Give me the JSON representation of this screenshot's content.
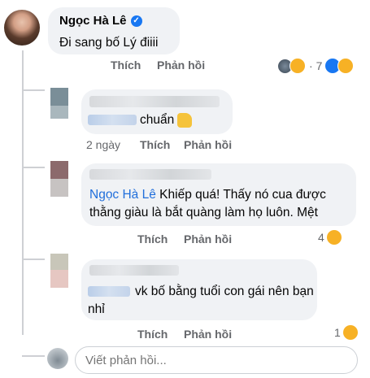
{
  "post": {
    "author": "Ngọc Hà Lê",
    "text": "Đi sang bố Lý điiii",
    "like_label": "Thích",
    "reply_label": "Phản hồi",
    "reaction_count": "7"
  },
  "comments": [
    {
      "text": "chuẩn",
      "time": "2 ngày",
      "like_label": "Thích",
      "reply_label": "Phản hồi"
    },
    {
      "mention": "Ngọc Hà Lê",
      "text_line1": "Khiếp quá! Thấy nó cua được",
      "text_line2": "thằng giàu là bắt quàng làm họ luôn. Mệt",
      "like_label": "Thích",
      "reply_label": "Phản hồi",
      "reaction_count": "4"
    },
    {
      "text_line1": "vk bố bằng tuổi con gái nên bạn",
      "text_line2": "nhỉ",
      "like_label": "Thích",
      "reply_label": "Phản hồi",
      "reaction_count": "1"
    }
  ],
  "reply_box": {
    "placeholder": "Viết phản hồi..."
  },
  "colors": {
    "bubble": "#f0f2f5",
    "action_text": "#65676b",
    "mention": "#216fdb",
    "verified": "#1877f2",
    "haha": "#f7b125"
  },
  "icons": [
    "verified-badge-icon",
    "thumbs-up-emoji-icon",
    "haha-reaction-icon",
    "like-reaction-icon",
    "love-reaction-icon"
  ]
}
